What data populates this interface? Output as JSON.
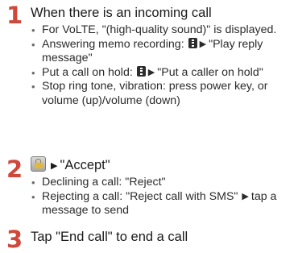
{
  "steps": [
    {
      "number": "1",
      "title": "When there is an incoming call",
      "bullets": {
        "volte": "For VoLTE, \"(high-quality sound)\" is displayed.",
        "memo_prefix": "Answering memo recording:",
        "memo_suffix": "\"Play reply message\"",
        "hold_prefix": "Put a call on hold:",
        "hold_suffix": "\"Put a caller on hold\"",
        "stop": "Stop ring tone, vibration: press power key, or volume (up)/volume (down)"
      }
    },
    {
      "number": "2",
      "title": "\"Accept\"",
      "bullets": {
        "decline": "Declining a call: \"Reject\"",
        "reject_prefix": "Rejecting a call: \"Reject call with SMS\"",
        "reject_suffix": "tap a message to send"
      }
    },
    {
      "number": "3",
      "title": "Tap \"End call\" to end a call"
    }
  ],
  "glyphs": {
    "arrow": "▶"
  },
  "icons": {
    "menu_key": "menu-key-icon",
    "lock_button": "lock-button-icon",
    "arrow": "arrow-right-icon"
  },
  "colors": {
    "step_number": "#d0483a",
    "text": "#1a1a1a"
  }
}
